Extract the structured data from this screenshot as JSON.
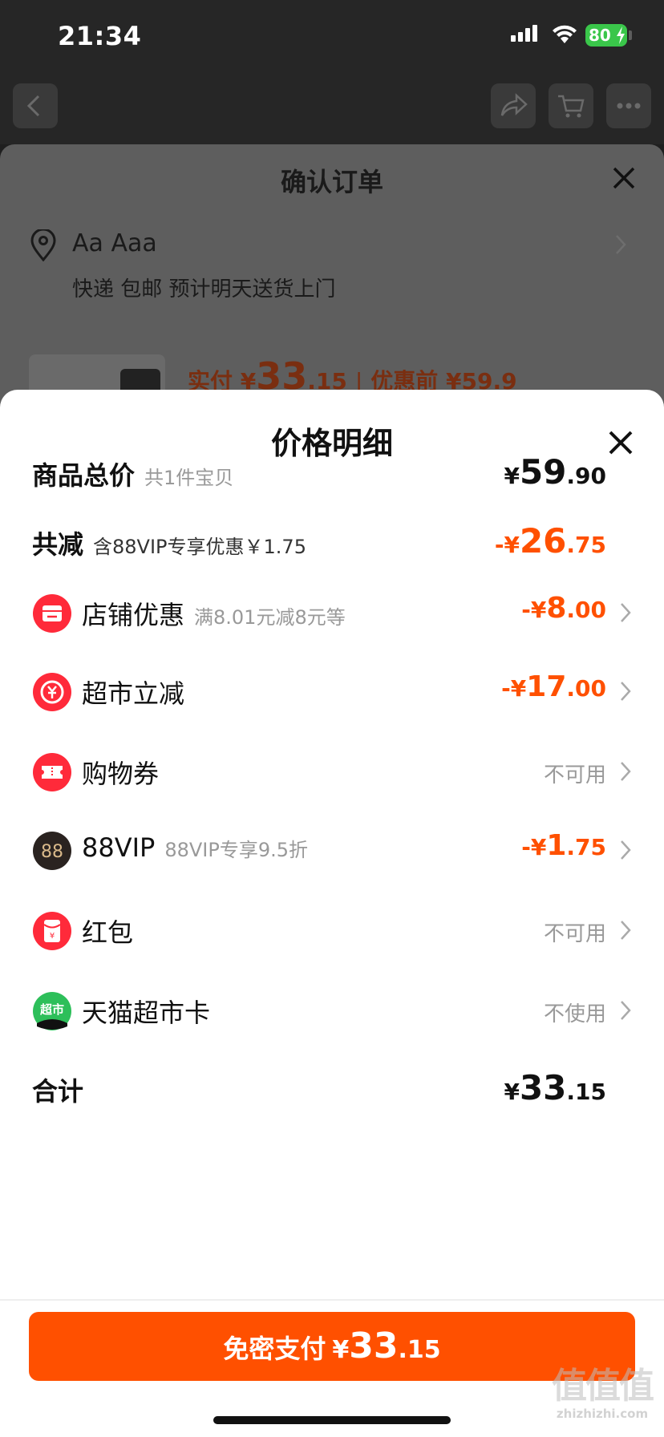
{
  "status_bar": {
    "time": "21:34",
    "battery": "80"
  },
  "order_sheet": {
    "title": "确认订单",
    "address_name": "Aa Aaa",
    "delivery": "快递 包邮 预计明天送货上门",
    "price_prefix": "实付 ¥",
    "price_int": "33",
    "price_dec": ".15",
    "price_before": "优惠前 ¥59.9"
  },
  "detail": {
    "title": "价格明细",
    "rows": [
      {
        "label": "商品总价",
        "note": "共1件宝贝",
        "cur": "¥",
        "int": "59",
        "dec": ".90"
      },
      {
        "label": "共减",
        "note": "含88VIP专享优惠￥1.75",
        "cur": "-¥",
        "int": "26",
        "dec": ".75"
      },
      {
        "label": "店铺优惠",
        "note": "满8.01元减8元等",
        "cur": "-¥",
        "int": "8",
        "dec": ".00",
        "icon": "shop-coupon-icon",
        "icon_color": "#ff2a3a"
      },
      {
        "label": "超市立减",
        "note": "",
        "cur": "-¥",
        "int": "17",
        "dec": ".00",
        "icon": "supermarket-discount-icon",
        "icon_color": "#ff2a3a"
      },
      {
        "label": "购物券",
        "status": "不可用",
        "icon": "shopping-voucher-icon",
        "icon_color": "#ff2a3a"
      },
      {
        "label": "88VIP",
        "note": "88VIP专享9.5折",
        "cur": "-¥",
        "int": "1",
        "dec": ".75",
        "icon": "88vip-icon",
        "icon_text": "88",
        "icon_color": "#2a2320"
      },
      {
        "label": "红包",
        "status": "不可用",
        "icon": "red-packet-icon",
        "icon_color": "#ff2a3a"
      },
      {
        "label": "天猫超市卡",
        "status": "不使用",
        "icon": "tmall-supermarket-card-icon",
        "icon_text": "超市",
        "icon_color": "#2dbf5a"
      },
      {
        "label": "合计",
        "cur": "¥",
        "int": "33",
        "dec": ".15"
      }
    ]
  },
  "pay_button": {
    "label": "免密支付",
    "cur": "¥",
    "int": "33",
    "dec": ".15"
  },
  "watermark": {
    "mark": "值值值",
    "url": "zhizhizhi.com"
  },
  "colors": {
    "accent": "#ff5000",
    "coupon_red": "#ff2a3a"
  }
}
